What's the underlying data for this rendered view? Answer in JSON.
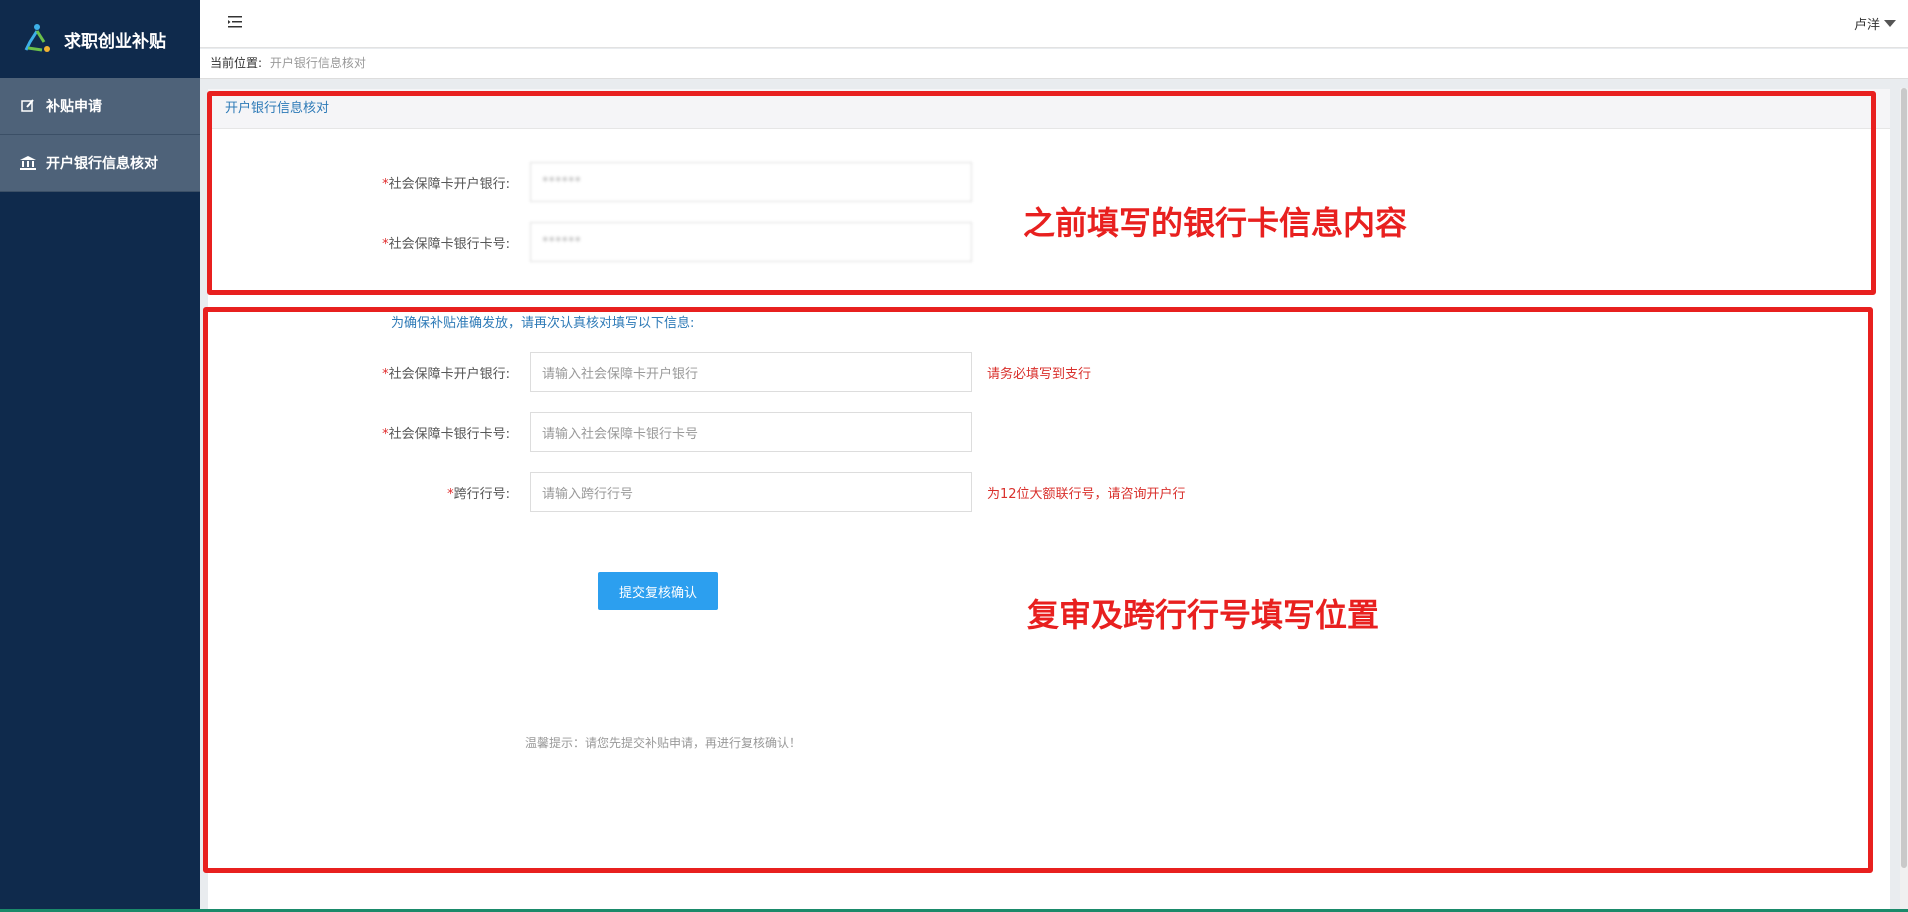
{
  "brand": {
    "title": "求职创业补贴"
  },
  "sidebar": {
    "items": [
      {
        "label": "补贴申请",
        "icon": "edit-icon"
      },
      {
        "label": "开户银行信息核对",
        "icon": "bank-icon"
      }
    ]
  },
  "header": {
    "user": "卢洋"
  },
  "breadcrumb": {
    "prefix": "当前位置:",
    "current": "开户银行信息核对"
  },
  "panel": {
    "title": "开户银行信息核对"
  },
  "existing": {
    "bank_label": "社会保障卡开户银行:",
    "bank_value": "******",
    "card_label": "社会保障卡银行卡号:",
    "card_value": "******"
  },
  "recheck": {
    "notice": "为确保补贴准确发放，请再次认真核对填写以下信息:",
    "bank_label": "社会保障卡开户银行:",
    "bank_placeholder": "请输入社会保障卡开户银行",
    "bank_hint": "请务必填写到支行",
    "card_label": "社会保障卡银行卡号:",
    "card_placeholder": "请输入社会保障卡银行卡号",
    "interbank_label": "跨行行号:",
    "interbank_placeholder": "请输入跨行行号",
    "interbank_hint": "为12位大额联行号，请咨询开户行",
    "required_mark": "*",
    "submit_label": "提交复核确认",
    "tip": "温馨提示：请您先提交补贴申请，再进行复核确认！"
  },
  "annotations": {
    "top_text": "之前填写的银行卡信息内容",
    "bottom_text": "复审及跨行行号填写位置",
    "color": "#e8201f"
  },
  "colors": {
    "sidebar": "#0f2a4c",
    "accent": "#2c9fef",
    "link": "#2d7ab7",
    "required": "#e02b2b"
  }
}
